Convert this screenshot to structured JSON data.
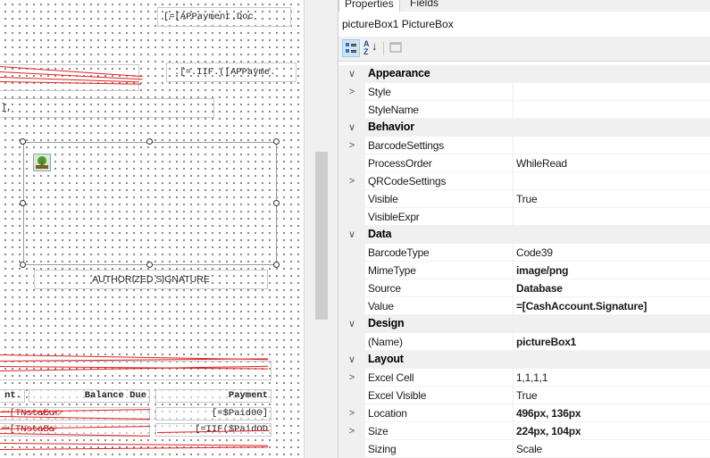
{
  "designer": {
    "top_expr": "[=[APPayment.Doc",
    "iif_expr": ".[=.IIF.([APPayme.",
    "bracket_text": "],",
    "signature_label": "AUTHORIZED SIGNATURE",
    "headers": {
      "amount": "nt.",
      "balance": "Balance Due",
      "payment": "Payment"
    },
    "row1": {
      "left": "ꟷ[TN̷s̷t̷a̷̷E̷u̷r̷",
      "mid": "",
      "right": "[=$Paid00]"
    },
    "row2": {
      "left": "ꟷ[TN̷s̷t̷a̷B̷a̷",
      "mid": "",
      "right": "[=IIF($PaidOD"
    }
  },
  "properties": {
    "tabs": [
      "Properties",
      "Fields"
    ],
    "object_selector": "pictureBox1  PictureBox",
    "toolbar": {
      "categorized": "categorized-icon",
      "alphabetical": "alphabetical-icon",
      "pages": "property-pages-icon"
    },
    "rows": [
      {
        "type": "category",
        "name": "Appearance",
        "expander": "∨"
      },
      {
        "type": "prop",
        "name": "Style",
        "value": "",
        "expander": ">"
      },
      {
        "type": "prop",
        "name": "StyleName",
        "value": ""
      },
      {
        "type": "category",
        "name": "Behavior",
        "expander": "∨"
      },
      {
        "type": "prop",
        "name": "BarcodeSettings",
        "value": "",
        "expander": ">"
      },
      {
        "type": "prop",
        "name": "ProcessOrder",
        "value": "WhileRead"
      },
      {
        "type": "prop",
        "name": "QRCodeSettings",
        "value": "",
        "expander": ">"
      },
      {
        "type": "prop",
        "name": "Visible",
        "value": "True"
      },
      {
        "type": "prop",
        "name": "VisibleExpr",
        "value": ""
      },
      {
        "type": "category",
        "name": "Data",
        "expander": "∨"
      },
      {
        "type": "prop",
        "name": "BarcodeType",
        "value": "Code39"
      },
      {
        "type": "prop",
        "name": "MimeType",
        "value": "image/png",
        "bold": true
      },
      {
        "type": "prop",
        "name": "Source",
        "value": "Database",
        "bold": true
      },
      {
        "type": "prop",
        "name": "Value",
        "value": "=[CashAccount.Signature]",
        "bold": true
      },
      {
        "type": "category",
        "name": "Design",
        "expander": "∨"
      },
      {
        "type": "prop",
        "name": "(Name)",
        "value": "pictureBox1",
        "bold": true
      },
      {
        "type": "category",
        "name": "Layout",
        "expander": "∨"
      },
      {
        "type": "prop",
        "name": "Excel Cell",
        "value": "1,1,1,1",
        "expander": ">"
      },
      {
        "type": "prop",
        "name": "Excel Visible",
        "value": "True"
      },
      {
        "type": "prop",
        "name": "Location",
        "value": "496px, 136px",
        "bold": true,
        "expander": ">"
      },
      {
        "type": "prop",
        "name": "Size",
        "value": "224px, 104px",
        "bold": true,
        "expander": ">"
      },
      {
        "type": "prop",
        "name": "Sizing",
        "value": "Scale"
      }
    ]
  }
}
